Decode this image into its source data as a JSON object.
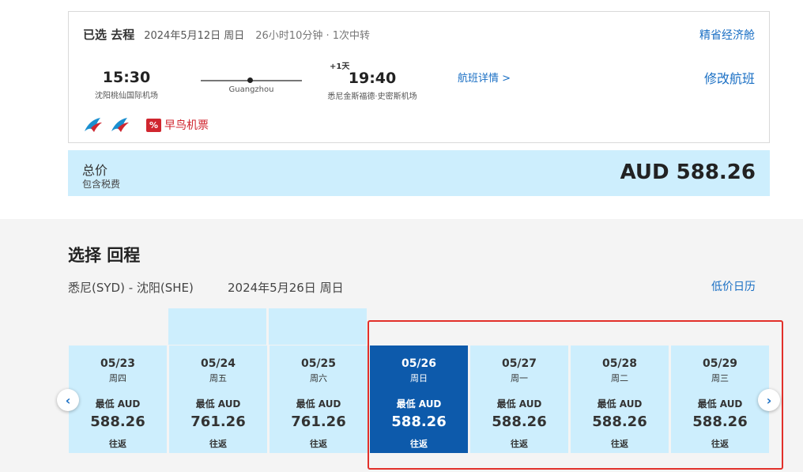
{
  "outbound": {
    "selected_label": "已选 去程",
    "date": "2024年5月12日 周日",
    "duration": "26小时10分钟 · 1次中转",
    "cabin": "精省经济舱",
    "dep_time": "15:30",
    "dep_airport": "沈阳桃仙国际机场",
    "via": "Guangzhou",
    "plus_day": "+1天",
    "arr_time": "19:40",
    "arr_airport": "悉尼金斯福德·史密斯机场",
    "detail_link": "航班详情 >",
    "modify_link": "修改航班",
    "early_badge": "%",
    "early_label": "早鸟机票"
  },
  "total": {
    "label": "总价",
    "sub": "包含税费",
    "price": "AUD 588.26"
  },
  "return": {
    "title": "选择 回程",
    "route": "悉尼(SYD) - 沈阳(SHE)",
    "date": "2024年5月26日 周日",
    "calendar_link": "低价日历"
  },
  "dates": [
    {
      "date": "05/23",
      "weekday": "周四",
      "low": "最低 AUD",
      "price": "588.26",
      "rt": "往返"
    },
    {
      "date": "05/24",
      "weekday": "周五",
      "low": "最低 AUD",
      "price": "761.26",
      "rt": "往返"
    },
    {
      "date": "05/25",
      "weekday": "周六",
      "low": "最低 AUD",
      "price": "761.26",
      "rt": "往返"
    },
    {
      "date": "05/26",
      "weekday": "周日",
      "low": "最低 AUD",
      "price": "588.26",
      "rt": "往返"
    },
    {
      "date": "05/27",
      "weekday": "周一",
      "low": "最低 AUD",
      "price": "588.26",
      "rt": "往返"
    },
    {
      "date": "05/28",
      "weekday": "周二",
      "low": "最低 AUD",
      "price": "588.26",
      "rt": "往返"
    },
    {
      "date": "05/29",
      "weekday": "周三",
      "low": "最低 AUD",
      "price": "588.26",
      "rt": "往返"
    }
  ],
  "nav": {
    "prev": "‹",
    "next": "›"
  },
  "colors": {
    "accent": "#1a6fc4",
    "selected": "#0d5aab",
    "cell": "#cdeefd",
    "highlight": "#e2302a",
    "promo": "#d0262f"
  }
}
